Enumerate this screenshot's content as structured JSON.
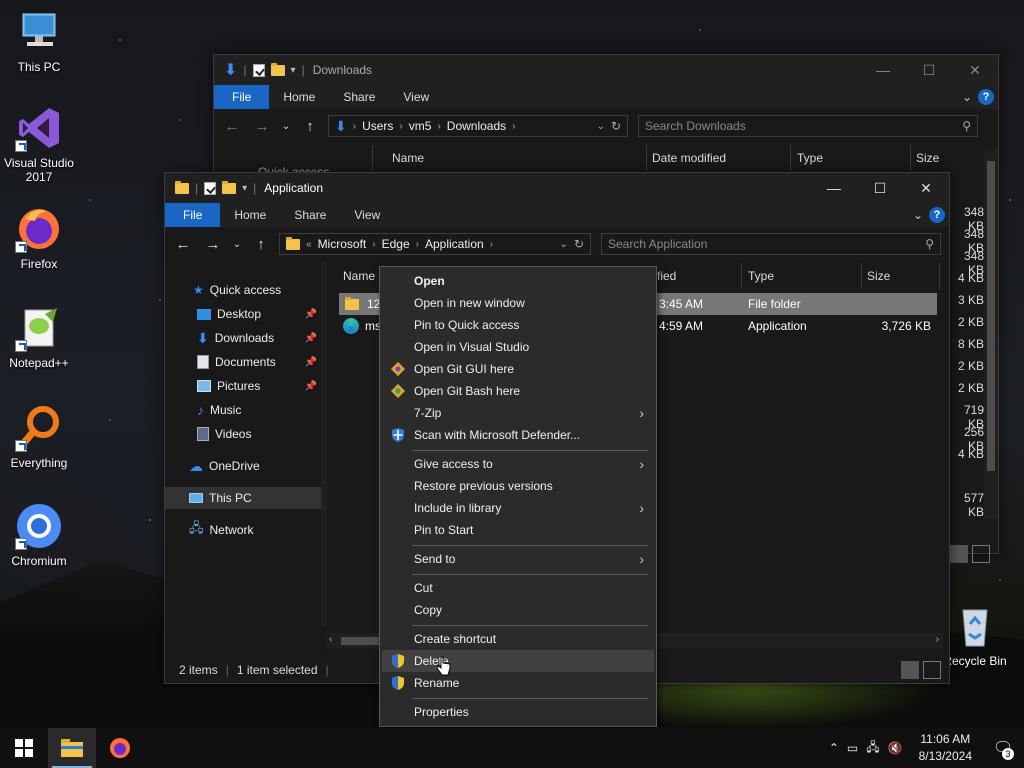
{
  "desktop": {
    "icons": [
      {
        "label": "This PC"
      },
      {
        "label": "Visual Studio 2017"
      },
      {
        "label": "Firefox"
      },
      {
        "label": "Notepad++"
      },
      {
        "label": "Everything"
      },
      {
        "label": "Chromium"
      },
      {
        "label": "Recycle Bin"
      }
    ]
  },
  "back_window": {
    "title": "Downloads",
    "ribbon": [
      "File",
      "Home",
      "Share",
      "View"
    ],
    "address": [
      "Users",
      "vm5",
      "Downloads"
    ],
    "search_placeholder": "Search Downloads",
    "columns": [
      "Name",
      "Date modified",
      "Type",
      "Size"
    ],
    "nav_partial": "Quick access",
    "sizes": [
      "348 KB",
      "348 KB",
      "348 KB",
      "4 KB",
      "3 KB",
      "2 KB",
      "8 KB",
      "2 KB",
      "2 KB",
      "719 KB",
      "256 KB",
      "4 KB",
      "577 KB"
    ]
  },
  "front_window": {
    "title": "Application",
    "ribbon": [
      "File",
      "Home",
      "Share",
      "View"
    ],
    "address_prefix": "«",
    "address": [
      "Microsoft",
      "Edge",
      "Application"
    ],
    "search_placeholder": "Search Application",
    "columns": [
      "Name",
      "Date modified",
      "Type",
      "Size"
    ],
    "column_partial": "fied",
    "nav": {
      "quick_access": "Quick access",
      "desktop": "Desktop",
      "downloads": "Downloads",
      "documents": "Documents",
      "pictures": "Pictures",
      "music": "Music",
      "videos": "Videos",
      "onedrive": "OneDrive",
      "this_pc": "This PC",
      "network": "Network"
    },
    "files": [
      {
        "name": "127",
        "date": "3:45 AM",
        "type": "File folder",
        "size": ""
      },
      {
        "name": "ms",
        "date": "4:59 AM",
        "type": "Application",
        "size": "3,726 KB"
      }
    ],
    "status": {
      "items": "2 items",
      "selected": "1 item selected"
    }
  },
  "context_menu": {
    "items": [
      "Open",
      "Open in new window",
      "Pin to Quick access",
      "Open in Visual Studio",
      "Open Git GUI here",
      "Open Git Bash here",
      "7-Zip",
      "Scan with Microsoft Defender...",
      "Give access to",
      "Restore previous versions",
      "Include in library",
      "Pin to Start",
      "Send to",
      "Cut",
      "Copy",
      "Create shortcut",
      "Delete",
      "Rename",
      "Properties"
    ]
  },
  "taskbar": {
    "time": "11:06 AM",
    "date": "8/13/2024",
    "notification_count": "3"
  }
}
